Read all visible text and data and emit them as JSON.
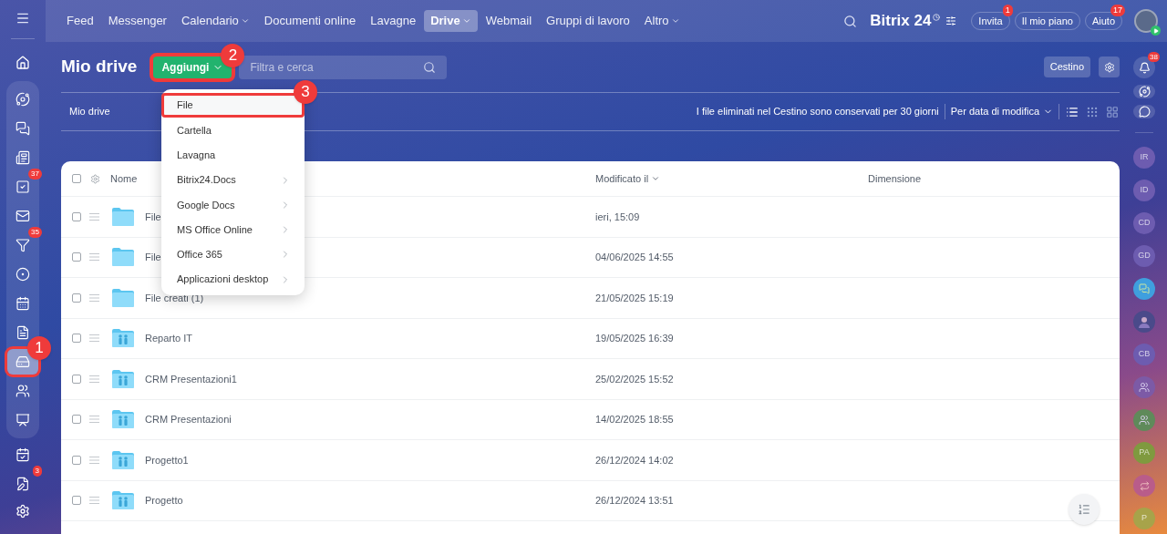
{
  "sidebar": {
    "items": [
      {
        "selected": false,
        "highlighted": false
      },
      {
        "selected": false,
        "highlighted": false
      },
      {
        "selected": false,
        "highlighted": false
      },
      {
        "selected": false,
        "highlighted": false,
        "badge": "37"
      },
      {
        "selected": false,
        "highlighted": false
      },
      {
        "selected": false,
        "highlighted": false,
        "badge": "35"
      },
      {
        "selected": false,
        "highlighted": false
      },
      {
        "selected": false,
        "highlighted": false
      },
      {
        "selected": false,
        "highlighted": false
      },
      {
        "selected": true,
        "highlighted": true,
        "marker": "1"
      },
      {
        "selected": false,
        "highlighted": false
      },
      {
        "selected": false,
        "highlighted": false
      },
      {
        "selected": false,
        "highlighted": false
      },
      {
        "selected": false,
        "highlighted": false,
        "badge": "3"
      }
    ]
  },
  "topbar": {
    "nav": [
      {
        "label": "Feed",
        "selected": false,
        "dropdown": false
      },
      {
        "label": "Messenger",
        "selected": false,
        "dropdown": false
      },
      {
        "label": "Calendario",
        "selected": false,
        "dropdown": true
      },
      {
        "label": "Documenti online",
        "selected": false,
        "dropdown": false
      },
      {
        "label": "Lavagne",
        "selected": false,
        "dropdown": false
      },
      {
        "label": "Drive",
        "selected": true,
        "dropdown": true
      },
      {
        "label": "Webmail",
        "selected": false,
        "dropdown": false
      },
      {
        "label": "Gruppi di lavoro",
        "selected": false,
        "dropdown": false
      },
      {
        "label": "Altro",
        "selected": false,
        "dropdown": true
      }
    ],
    "logo": {
      "name": "Bitrix",
      "number": "24"
    },
    "buttons": [
      {
        "label": "Invita",
        "badge": "1"
      },
      {
        "label": "Il mio piano"
      },
      {
        "label": "Aiuto",
        "badge": "17"
      }
    ]
  },
  "header": {
    "title": "Mio drive",
    "add_button": {
      "label": "Aggiungi",
      "highlighted": true,
      "marker": "2"
    },
    "search": {
      "placeholder": "Filtra e cerca"
    },
    "trash_button": "Cestino"
  },
  "add_menu": {
    "items": [
      {
        "label": "File",
        "kind": "action",
        "highlighted": true,
        "marker": "3"
      },
      {
        "label": "Cartella",
        "kind": "action",
        "highlighted": false
      },
      {
        "label": "Lavagna",
        "kind": "action",
        "highlighted": false
      },
      {
        "label": "Bitrix24.Docs",
        "kind": "submenu",
        "highlighted": false
      },
      {
        "label": "Google Docs",
        "kind": "submenu",
        "highlighted": false
      },
      {
        "label": "MS Office Online",
        "kind": "submenu",
        "highlighted": false
      },
      {
        "label": "Office 365",
        "kind": "submenu",
        "highlighted": false
      },
      {
        "label": "Applicazioni desktop",
        "kind": "submenu",
        "highlighted": false
      }
    ]
  },
  "toolbar": {
    "breadcrumb": "Mio drive",
    "info": "I file eliminati nel Cestino sono conservati per 30 giorni",
    "sort": "Per data di modifica",
    "views": [
      {
        "selected": true
      },
      {
        "selected": false
      },
      {
        "selected": false
      }
    ]
  },
  "table": {
    "select_all": {
      "checked": false
    },
    "columns": [
      "Nome",
      "Modificato il",
      "Dimensione"
    ],
    "rows": [
      {
        "name": "File",
        "modified": "ieri, 15:09",
        "kind": "folder",
        "checked": false
      },
      {
        "name": "File",
        "modified": "04/06/2025 14:55",
        "kind": "folder",
        "checked": false
      },
      {
        "name": "File creati (1)",
        "modified": "21/05/2025 15:19",
        "kind": "folder",
        "checked": false
      },
      {
        "name": "Reparto IT",
        "modified": "19/05/2025 16:39",
        "kind": "shared",
        "checked": false
      },
      {
        "name": "CRM Presentazioni1",
        "modified": "25/02/2025 15:52",
        "kind": "shared",
        "checked": false
      },
      {
        "name": "CRM Presentazioni",
        "modified": "14/02/2025 18:55",
        "kind": "shared",
        "checked": false
      },
      {
        "name": "Progetto1",
        "modified": "26/12/2024 14:02",
        "kind": "shared",
        "checked": false
      },
      {
        "name": "Progetto",
        "modified": "26/12/2024 13:51",
        "kind": "shared",
        "checked": false
      }
    ]
  },
  "right_panel": {
    "notifications_badge": "38",
    "contacts": [
      {
        "kind": "initials",
        "text": "IR",
        "color": "#6d5cb0"
      },
      {
        "kind": "initials",
        "text": "ID",
        "color": "#6d5cb0"
      },
      {
        "kind": "initials",
        "text": "CD",
        "color": "#6d5cb0"
      },
      {
        "kind": "initials",
        "text": "GD",
        "color": "#6d5cb0"
      },
      {
        "kind": "chat",
        "color": "#3f9fde"
      },
      {
        "kind": "photo",
        "color": "#4a4a8a"
      },
      {
        "kind": "initials",
        "text": "CB",
        "color": "#6d5cb0"
      },
      {
        "kind": "group",
        "color": "#7c5aa6"
      },
      {
        "kind": "group",
        "color": "#5f8a5a"
      },
      {
        "kind": "initials",
        "text": "PA",
        "color": "#7f9a3f"
      },
      {
        "kind": "swirl",
        "color": "#b95c8a"
      },
      {
        "kind": "initials",
        "text": "P",
        "color": "#a7a34a"
      }
    ]
  }
}
